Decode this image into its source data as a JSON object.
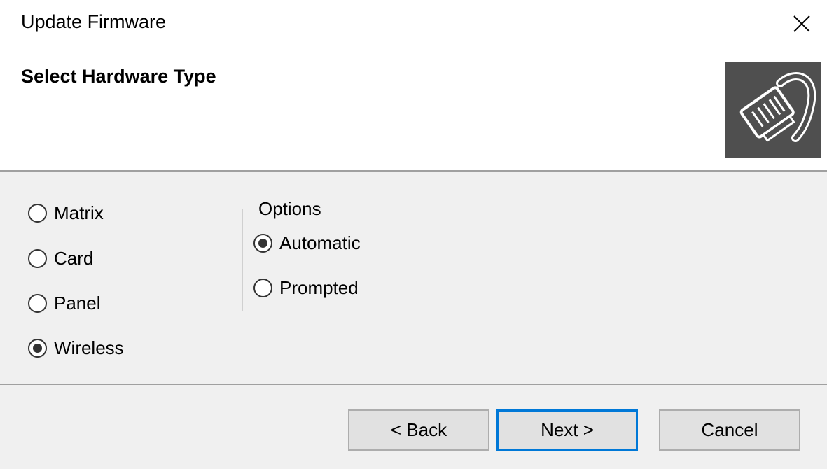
{
  "window": {
    "title": "Update Firmware"
  },
  "header": {
    "heading": "Select Hardware Type",
    "image_icon": "network-cable-icon"
  },
  "hardware_types": [
    {
      "label": "Matrix",
      "checked": false
    },
    {
      "label": "Card",
      "checked": false
    },
    {
      "label": "Panel",
      "checked": false
    },
    {
      "label": "Wireless",
      "checked": true
    }
  ],
  "options": {
    "title": "Options",
    "items": [
      {
        "label": "Automatic",
        "checked": true
      },
      {
        "label": "Prompted",
        "checked": false
      }
    ]
  },
  "buttons": {
    "back": "< Back",
    "next": "Next >",
    "cancel": "Cancel"
  },
  "colors": {
    "accent": "#0078d7",
    "panel_bg": "#f0f0f0",
    "button_bg": "#e1e1e1"
  }
}
